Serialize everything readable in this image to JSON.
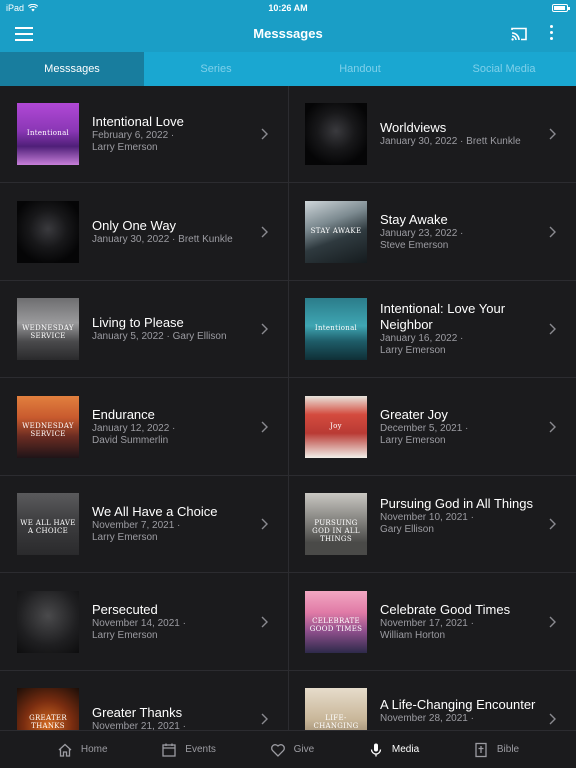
{
  "status": {
    "device": "iPad",
    "time": "10:26 AM"
  },
  "header": {
    "title": "Messsages"
  },
  "tabs": [
    {
      "label": "Messsages",
      "active": true
    },
    {
      "label": "Series",
      "active": false
    },
    {
      "label": "Handout",
      "active": false
    },
    {
      "label": "Social Media",
      "active": false
    }
  ],
  "sermons": [
    {
      "title": "Intentional Love",
      "meta1": "February 6, 2022 ·",
      "meta2": "Larry Emerson",
      "thumb_text": "Intentional",
      "thumb": "purple"
    },
    {
      "title": "Worldviews",
      "meta1": "January 30, 2022 · Brett Kunkle",
      "meta2": "",
      "thumb_text": "",
      "thumb": "dark"
    },
    {
      "title": "Only One Way",
      "meta1": "January 30, 2022 · Brett Kunkle",
      "meta2": "",
      "thumb_text": "",
      "thumb": "dark"
    },
    {
      "title": "Stay Awake",
      "meta1": "January 23, 2022 ·",
      "meta2": "Steve Emerson",
      "thumb_text": "STAY AWAKE",
      "thumb": "mountain"
    },
    {
      "title": "Living to Please",
      "meta1": "January 5, 2022 · Gary Ellison",
      "meta2": "",
      "thumb_text": "WEDNESDAY SERVICE",
      "thumb": "gray"
    },
    {
      "title": "Intentional: Love Your Neighbor",
      "meta1": "January 16, 2022 ·",
      "meta2": "Larry Emerson",
      "thumb_text": "Intentional",
      "thumb": "teal"
    },
    {
      "title": "Endurance",
      "meta1": "January 12, 2022 ·",
      "meta2": "David Summerlin",
      "thumb_text": "WEDNESDAY SERVICE",
      "thumb": "sunset"
    },
    {
      "title": "Greater Joy",
      "meta1": "December 5, 2021 ·",
      "meta2": "Larry Emerson",
      "thumb_text": "Joy",
      "thumb": "joy"
    },
    {
      "title": "We All Have a Choice",
      "meta1": "November 7, 2021 ·",
      "meta2": "Larry Emerson",
      "thumb_text": "WE ALL HAVE A CHOICE",
      "thumb": "road"
    },
    {
      "title": "Pursuing God in All Things",
      "meta1": "November 10, 2021 ·",
      "meta2": "Gary Ellison",
      "thumb_text": "PURSUING GOD IN ALL THINGS",
      "thumb": "clouds"
    },
    {
      "title": "Persecuted",
      "meta1": "November 14, 2021 ·",
      "meta2": "Larry Emerson",
      "thumb_text": "",
      "thumb": "hands"
    },
    {
      "title": "Celebrate Good Times",
      "meta1": "November 17, 2021 ·",
      "meta2": "William Horton",
      "thumb_text": "CELEBRATE GOOD TIMES",
      "thumb": "pink"
    },
    {
      "title": "Greater Thanks",
      "meta1": "November 21, 2021 ·",
      "meta2": "",
      "thumb_text": "GREATER THANKS",
      "thumb": "autumn"
    },
    {
      "title": "A Life-Changing Encounter",
      "meta1": "November 28, 2021 ·",
      "meta2": "",
      "thumb_text": "LIFE-CHANGING ENCOUNTER",
      "thumb": "beige"
    }
  ],
  "nav": [
    {
      "label": "Home",
      "icon": "home-icon",
      "active": false
    },
    {
      "label": "Events",
      "icon": "calendar-icon",
      "active": false
    },
    {
      "label": "Give",
      "icon": "heart-icon",
      "active": false
    },
    {
      "label": "Media",
      "icon": "microphone-icon",
      "active": true
    },
    {
      "label": "Bible",
      "icon": "bible-icon",
      "active": false
    }
  ],
  "colors": {
    "brand": "#1a9ec6",
    "tab_active": "#187d9e",
    "background": "#1b1b1d",
    "muted_text": "#9c9ca2"
  }
}
